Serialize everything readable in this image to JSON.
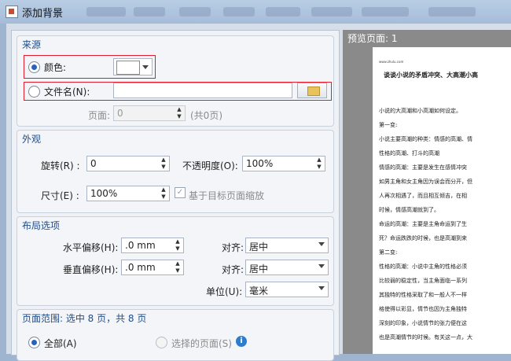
{
  "window": {
    "title": "添加背景"
  },
  "source": {
    "group_title": "来源",
    "color_label": "颜色:",
    "file_label": "文件名(N):",
    "file_value": "",
    "page_label": "页面:",
    "page_value": "0",
    "page_total": "(共0页)"
  },
  "appearance": {
    "group_title": "外观",
    "rotation_label": "旋转(R) :",
    "rotation_value": "0",
    "opacity_label": "不透明度(O):",
    "opacity_value": "100%",
    "size_label": "尺寸(E) :",
    "size_value": "100%",
    "scale_label": "基于目标页面缩放"
  },
  "layout": {
    "group_title": "布局选项",
    "h_offset_label": "水平偏移(H):",
    "h_offset_value": ".0 mm",
    "align1_label": "对齐:",
    "align1_value": "居中",
    "v_offset_label": "垂直偏移(H):",
    "v_offset_value": ".0 mm",
    "align2_label": "对齐:",
    "align2_value": "居中",
    "unit_label": "单位(U):",
    "unit_value": "毫米"
  },
  "page_range": {
    "group_title": "页面范围: 选中 8 页，共 8 页",
    "all_label": "全部(A)",
    "selected_label": "选择的页面(S)"
  },
  "preview": {
    "title": "预览页面: 1",
    "site": "www.zhulu.com",
    "doc_title": "谈谈小说的矛盾冲突、大高潮小高",
    "lines": [
      "小说的大高潮和小高潮如何设定。",
      "第一变:",
      "小说主要高潮的种类：情感的高潮、情",
      "性格的高潮、打斗的高潮",
      "情感的高潮：主要是发生在感情冲突",
      "如男主角和女主角因为误会而分开，但",
      "人再次相遇了，而且相互倾吉，在相",
      "时候，情感高潮就到了。",
      "命运的高潮：主要是主角命运到了生",
      "死？命运跌跌的时候，也是高潮到来",
      "第二变:",
      "性格的高潮：小说中主角的性格必须",
      "比较弱的稳定性，当主角面临一系列",
      "其独特的性格采取了和一般人不一样",
      "格使得以彩显，情节也因为主角独特",
      "深刻的印象，小说情节的张力便在这",
      "也是高潮情节的时候。有关这一点，大"
    ]
  }
}
